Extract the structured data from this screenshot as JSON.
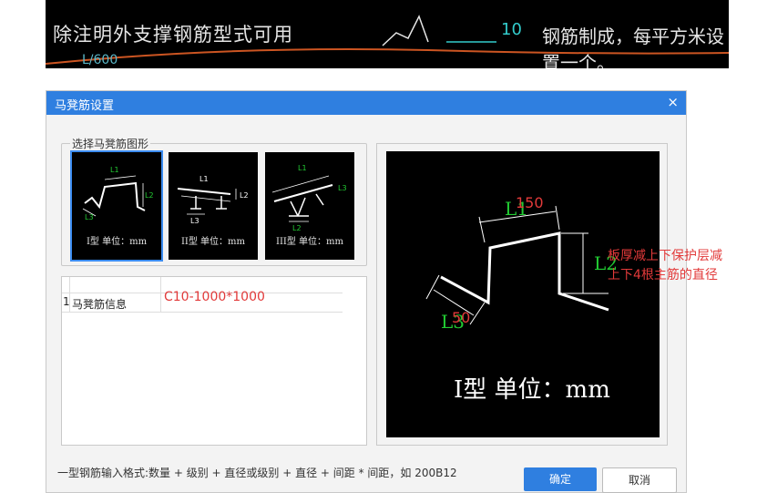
{
  "background": {
    "cad_text": "除注明外支撑钢筋型式可用",
    "cad_dim": "10",
    "cad_right": "钢筋制成，每平方米设置一个。",
    "cad_bottom": "L/600"
  },
  "dialog": {
    "title": "马凳筋设置",
    "close": "×",
    "group_label": "选择马凳筋图形",
    "shapes": [
      {
        "caption": "I型  单位：mm",
        "labels": [
          "L1",
          "L2",
          "L3"
        ],
        "selected": true
      },
      {
        "caption": "II型  单位：mm",
        "labels": [
          "L1",
          "L2",
          "L3"
        ],
        "selected": false
      },
      {
        "caption": "III型  单位：mm",
        "labels": [
          "L1",
          "L2",
          "L3"
        ],
        "selected": false
      }
    ],
    "table": {
      "rows": [
        {
          "num": "1",
          "name": "马凳筋信息",
          "value": "C10-1000*1000"
        }
      ]
    },
    "preview": {
      "l1": "L1",
      "l1_value": "150",
      "l2": "L2",
      "l3": "L3",
      "l3_value": "50",
      "caption": "I型  单位：mm"
    },
    "hint": "一型钢筋输入格式:数量 + 级别 + 直径或级别 + 直径 + 间距 * 间距，如 200B12",
    "ok_label": "确定",
    "cancel_label": "取消"
  },
  "annotation": {
    "line1": "板厚减上下保护层减",
    "line2": "上下4根主筋的直径"
  },
  "colors": {
    "title_bar": "#2f7fe0",
    "cad_green": "#22cc33",
    "red_text": "#e23a3a"
  }
}
